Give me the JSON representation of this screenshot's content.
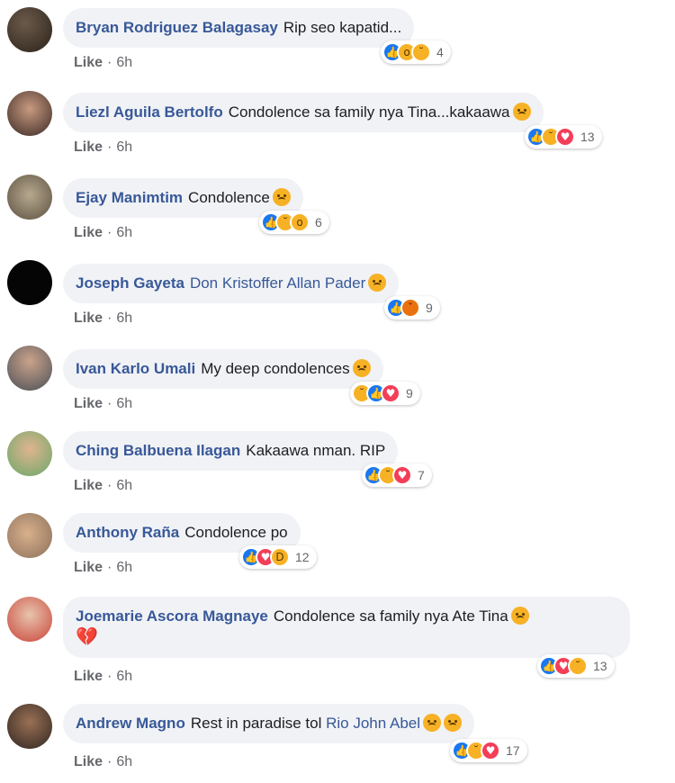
{
  "like_label": "Like",
  "separator": "·",
  "comments": [
    {
      "author": "Bryan Rodriguez Balagasay",
      "text": "Rip seo kapatid...",
      "mention": "",
      "time": "6h",
      "reactions": [
        "like",
        "wow",
        "sad"
      ],
      "count": "4",
      "emoji": false
    },
    {
      "author": "Liezl Aguila Bertolfo",
      "text": "Condolence sa family nya Tina...kakaawa",
      "mention": "",
      "time": "6h",
      "reactions": [
        "like",
        "sad",
        "heart"
      ],
      "count": "13",
      "emoji": true
    },
    {
      "author": "Ejay Manimtim",
      "text": "Condolence",
      "mention": "",
      "time": "6h",
      "reactions": [
        "like",
        "sad",
        "wow"
      ],
      "count": "6",
      "emoji": true
    },
    {
      "author": "Joseph Gayeta",
      "text": "",
      "mention": "Don Kristoffer Allan Pader",
      "time": "6h",
      "reactions": [
        "like",
        "angry"
      ],
      "count": "9",
      "emoji": true
    },
    {
      "author": "Ivan Karlo Umali",
      "text": "My deep condolences",
      "mention": "",
      "time": "6h",
      "reactions": [
        "sad",
        "like",
        "heart"
      ],
      "count": "9",
      "emoji": true
    },
    {
      "author": "Ching Balbuena Ilagan",
      "text": "Kakaawa nman. RIP",
      "mention": "",
      "time": "6h",
      "reactions": [
        "like",
        "sad",
        "heart"
      ],
      "count": "7",
      "emoji": false
    },
    {
      "author": "Anthony Raña",
      "text": "Condolence po",
      "mention": "",
      "time": "6h",
      "reactions": [
        "like",
        "heart",
        "haha"
      ],
      "count": "12",
      "emoji": false
    },
    {
      "author": "Joemarie Ascora Magnaye",
      "text": "Condolence sa family nya Ate Tina",
      "mention": "",
      "time": "6h",
      "reactions": [
        "like",
        "heart",
        "sad"
      ],
      "count": "13",
      "emoji": true
    },
    {
      "author": "Andrew Magno",
      "text": "Rest in paradise tol",
      "mention": "Rio John Abel",
      "time": "6h",
      "reactions": [
        "like",
        "sad",
        "heart"
      ],
      "count": "17",
      "emoji": true
    }
  ]
}
